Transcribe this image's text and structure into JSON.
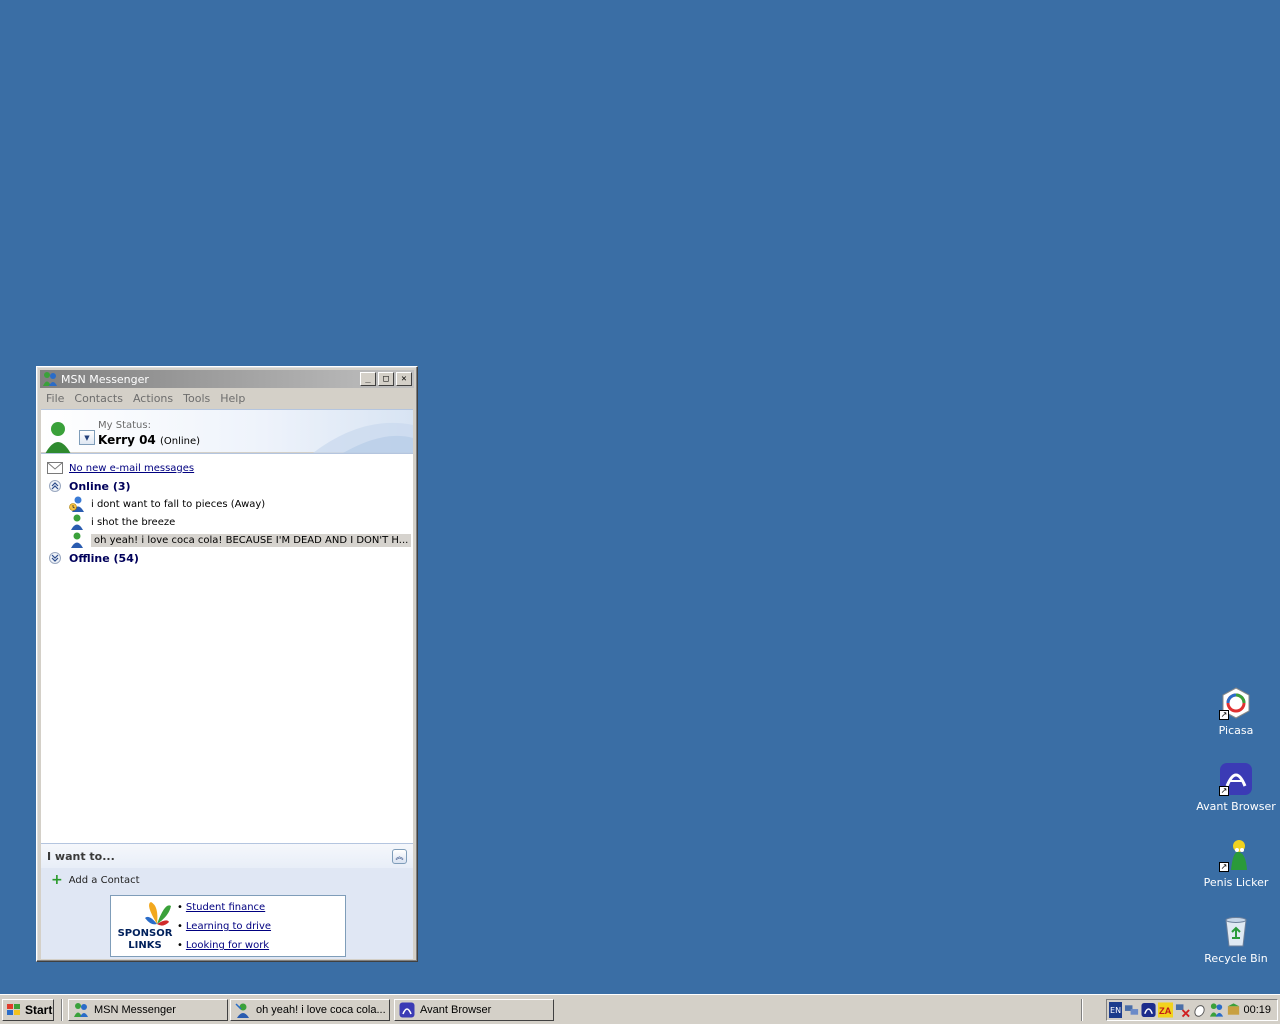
{
  "window": {
    "title": "MSN Messenger",
    "controls": {
      "minimize": "_",
      "maximize": "□",
      "close": "✕"
    }
  },
  "menu": [
    "File",
    "Contacts",
    "Actions",
    "Tools",
    "Help"
  ],
  "status": {
    "label": "My Status:",
    "name": "Kerry 04",
    "state": "(Online)"
  },
  "contacts": {
    "email_link": "No new e-mail messages",
    "online_group": "Online (3)",
    "online": [
      {
        "name": "i dont want to fall to pieces (Away)",
        "status": "away"
      },
      {
        "name": "i shot the breeze",
        "status": "online"
      },
      {
        "name": "oh yeah! i love coca cola! BECAUSE I'M DEAD AND I DON'T H...",
        "status": "online",
        "selected": true
      }
    ],
    "offline_group": "Offline (54)"
  },
  "iwant": {
    "title": "I want to...",
    "add_contact": "Add a Contact"
  },
  "sponsor": {
    "brand": "SPONSOR LINKS",
    "links": [
      "Student finance",
      "Learning to drive",
      "Looking for work"
    ]
  },
  "desktop_icons": [
    {
      "label": "Picasa",
      "icon": "picasa-icon"
    },
    {
      "label": "Avant Browser",
      "icon": "avant-browser-icon"
    },
    {
      "label": "Penis Licker",
      "icon": "green-character-icon"
    },
    {
      "label": "Recycle Bin",
      "icon": "recycle-bin-icon"
    }
  ],
  "taskbar": {
    "start": "Start",
    "tasks": [
      {
        "label": "MSN Messenger",
        "icon": "msn-icon"
      },
      {
        "label": "oh yeah! i love coca cola...",
        "icon": "chat-icon"
      },
      {
        "label": "Avant Browser",
        "icon": "avant-browser-icon"
      }
    ],
    "lang": "EN",
    "clock": "00:19"
  },
  "colors": {
    "desktop": "#3a6ea5",
    "taskbar": "#d4d0c8",
    "link": "#000080"
  }
}
